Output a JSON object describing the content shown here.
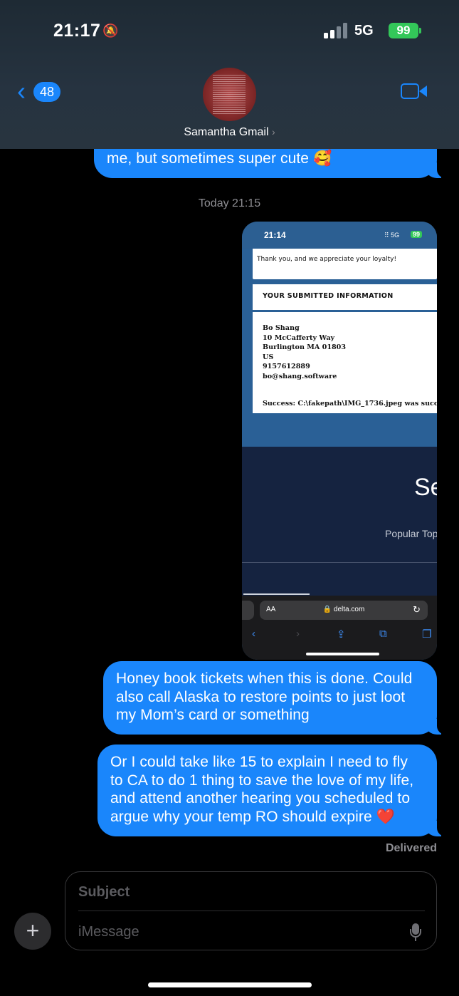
{
  "status_bar": {
    "time": "21:17",
    "network": "5G",
    "battery": "99"
  },
  "header": {
    "back_count": "48",
    "contact_name": "Samantha Gmail",
    "contact_chevron": "›"
  },
  "messages": {
    "previous_tail": "me, but sometimes super cute 🥰",
    "timestamp": "Today 21:15",
    "attachment": {
      "status_time": "21:14",
      "status_network": "5G",
      "status_battery": "99",
      "thank_you": "Thank you, and we appreciate your loyalty!",
      "section_title": "YOUR SUBMITTED INFORMATION",
      "address_lines": [
        "Bo Shang",
        "10 McCafferty Way",
        "Burlington MA 01803",
        "US",
        "9157612889",
        "bo@shang.software"
      ],
      "success_text": "Success: C:\\fakepath\\IMG_1736.jpeg was succe",
      "navy_heading": "Se",
      "navy_subtitle": "Popular Top",
      "url_aa": "AA",
      "url_domain": "🔒 delta.com"
    },
    "message_1": "Honey book tickets when this is done. Could also call Alaska to restore points to just loot my Mom’s card or something",
    "message_2": "Or I could take like 15 to explain I need to fly to CA to do 1 thing to save the love of my life, and attend another hearing you scheduled to argue why your temp RO should expire ❤️",
    "delivered": "Delivered"
  },
  "composer": {
    "subject_placeholder": "Subject",
    "message_placeholder": "iMessage"
  },
  "colors": {
    "bubble_blue": "#1a86fb",
    "battery_green": "#33c759"
  }
}
